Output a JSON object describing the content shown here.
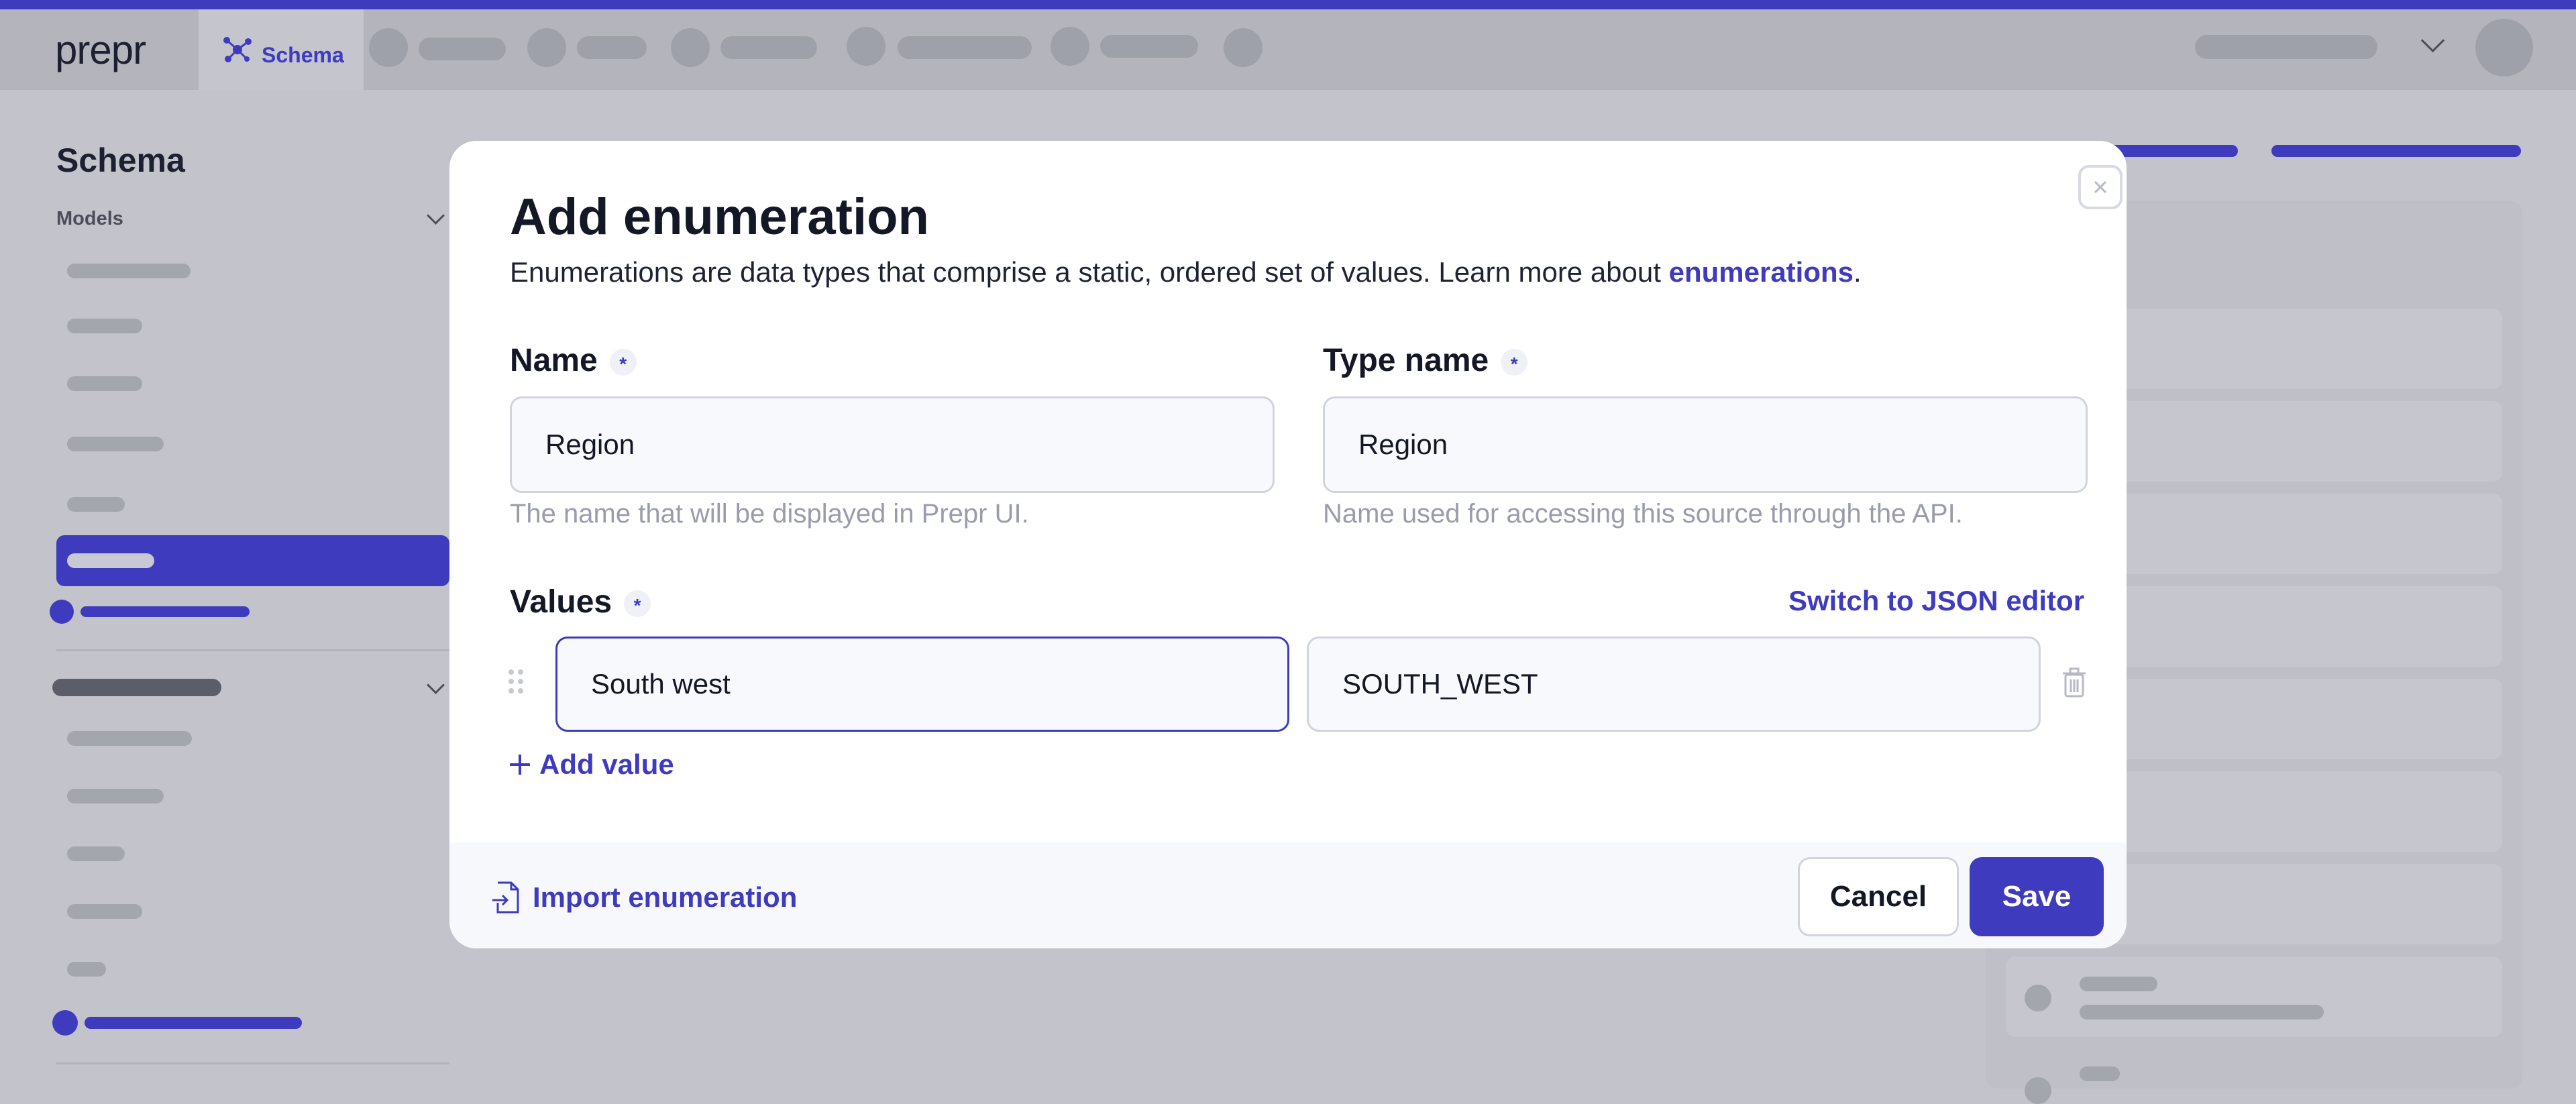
{
  "app": {
    "logo_text": "prepr",
    "active_tab": "Schema",
    "accent": "#3f3bbf"
  },
  "sidebar": {
    "title": "Schema",
    "section_label": "Models"
  },
  "modal": {
    "title": "Add enumeration",
    "description_prefix": "Enumerations are data types that comprise a static, ordered set of values. Learn more about ",
    "description_link": "enumerations",
    "description_suffix": ".",
    "name_field": {
      "label": "Name",
      "required_mark": "*",
      "value": "Region",
      "hint": "The name that will be displayed in Prepr UI."
    },
    "type_name_field": {
      "label": "Type name",
      "required_mark": "*",
      "value": "Region",
      "hint": "Name used for accessing this source through the API."
    },
    "values": {
      "label": "Values",
      "required_mark": "*",
      "switch_link": "Switch to JSON editor",
      "rows": [
        {
          "label": "South west",
          "key": "SOUTH_WEST"
        }
      ],
      "add_value": "Add value"
    },
    "footer": {
      "import_label": "Import enumeration",
      "cancel_label": "Cancel",
      "save_label": "Save"
    }
  }
}
